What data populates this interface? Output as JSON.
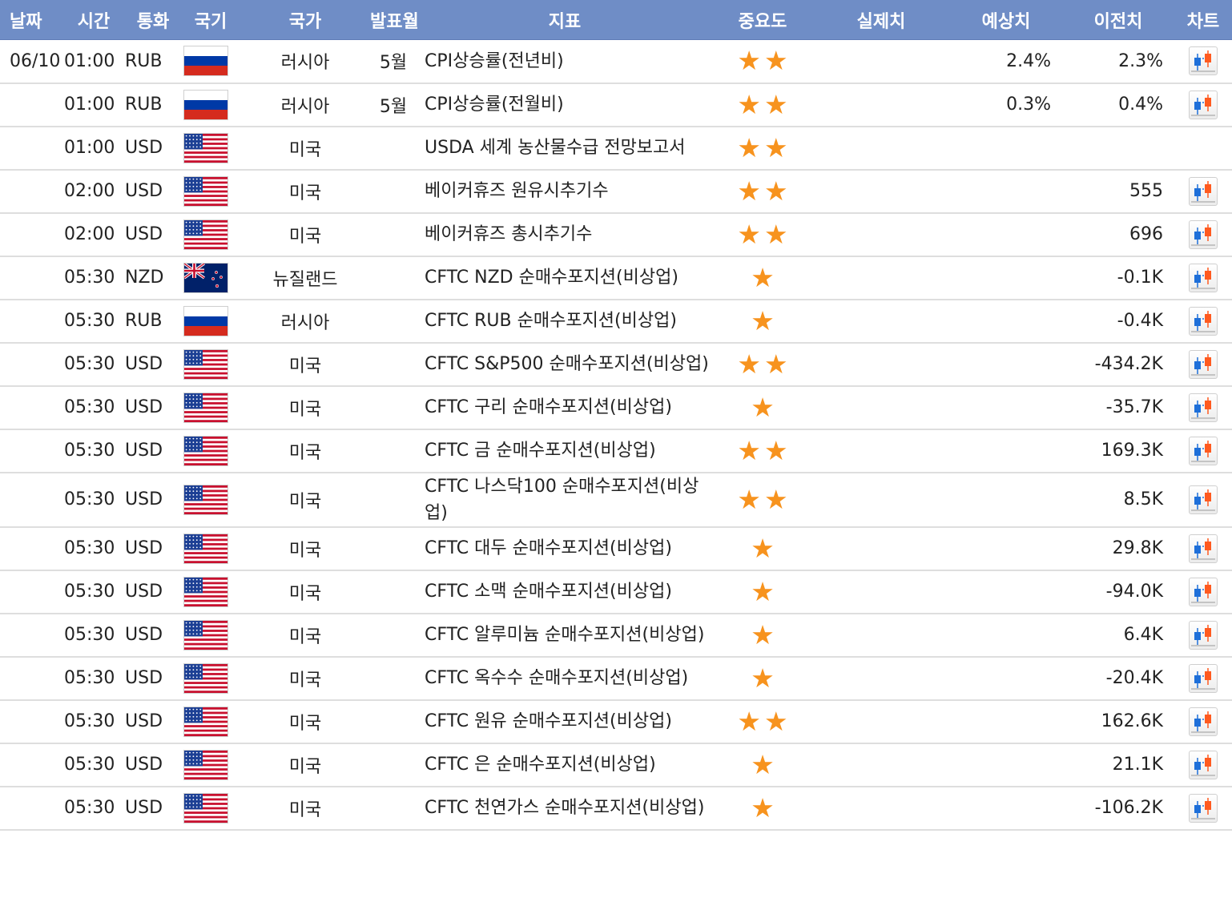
{
  "headers": [
    "날짜",
    "시간",
    "통화",
    "국기",
    "국가",
    "발표월",
    "지표",
    "중요도",
    "실제치",
    "예상치",
    "이전치",
    "차트"
  ],
  "colors": {
    "header_bg": "#6f8dc6",
    "star": "#f7931e",
    "row_border": "#dedede"
  },
  "rows": [
    {
      "date": "06/10",
      "time": "01:00",
      "currency": "RUB",
      "flag": "russia-flag",
      "country": "러시아",
      "month": "5월",
      "indicator": "CPI상승률(전년비)",
      "stars": 2,
      "actual": "",
      "forecast": "2.4%",
      "previous": "2.3%",
      "chart": true
    },
    {
      "date": "",
      "time": "01:00",
      "currency": "RUB",
      "flag": "russia-flag",
      "country": "러시아",
      "month": "5월",
      "indicator": "CPI상승률(전월비)",
      "stars": 2,
      "actual": "",
      "forecast": "0.3%",
      "previous": "0.4%",
      "chart": true
    },
    {
      "date": "",
      "time": "01:00",
      "currency": "USD",
      "flag": "usa-flag",
      "country": "미국",
      "month": "",
      "indicator": "USDA 세계 농산물수급 전망보고서",
      "stars": 2,
      "actual": "",
      "forecast": "",
      "previous": "",
      "chart": false
    },
    {
      "date": "",
      "time": "02:00",
      "currency": "USD",
      "flag": "usa-flag",
      "country": "미국",
      "month": "",
      "indicator": "베이커휴즈 원유시추기수",
      "stars": 2,
      "actual": "",
      "forecast": "",
      "previous": "555",
      "chart": true
    },
    {
      "date": "",
      "time": "02:00",
      "currency": "USD",
      "flag": "usa-flag",
      "country": "미국",
      "month": "",
      "indicator": "베이커휴즈 총시추기수",
      "stars": 2,
      "actual": "",
      "forecast": "",
      "previous": "696",
      "chart": true
    },
    {
      "date": "",
      "time": "05:30",
      "currency": "NZD",
      "flag": "newzealand-flag",
      "country": "뉴질랜드",
      "month": "",
      "indicator": "CFTC NZD 순매수포지션(비상업)",
      "stars": 1,
      "actual": "",
      "forecast": "",
      "previous": "-0.1K",
      "chart": true
    },
    {
      "date": "",
      "time": "05:30",
      "currency": "RUB",
      "flag": "russia-flag",
      "country": "러시아",
      "month": "",
      "indicator": "CFTC RUB 순매수포지션(비상업)",
      "stars": 1,
      "actual": "",
      "forecast": "",
      "previous": "-0.4K",
      "chart": true
    },
    {
      "date": "",
      "time": "05:30",
      "currency": "USD",
      "flag": "usa-flag",
      "country": "미국",
      "month": "",
      "indicator": "CFTC S&P500 순매수포지션(비상업)",
      "stars": 2,
      "actual": "",
      "forecast": "",
      "previous": "-434.2K",
      "chart": true
    },
    {
      "date": "",
      "time": "05:30",
      "currency": "USD",
      "flag": "usa-flag",
      "country": "미국",
      "month": "",
      "indicator": "CFTC 구리 순매수포지션(비상업)",
      "stars": 1,
      "actual": "",
      "forecast": "",
      "previous": "-35.7K",
      "chart": true
    },
    {
      "date": "",
      "time": "05:30",
      "currency": "USD",
      "flag": "usa-flag",
      "country": "미국",
      "month": "",
      "indicator": "CFTC 금 순매수포지션(비상업)",
      "stars": 2,
      "actual": "",
      "forecast": "",
      "previous": "169.3K",
      "chart": true
    },
    {
      "date": "",
      "time": "05:30",
      "currency": "USD",
      "flag": "usa-flag",
      "country": "미국",
      "month": "",
      "indicator": "CFTC 나스닥100 순매수포지션(비상업)",
      "stars": 2,
      "actual": "",
      "forecast": "",
      "previous": "8.5K",
      "chart": true
    },
    {
      "date": "",
      "time": "05:30",
      "currency": "USD",
      "flag": "usa-flag",
      "country": "미국",
      "month": "",
      "indicator": "CFTC 대두 순매수포지션(비상업)",
      "stars": 1,
      "actual": "",
      "forecast": "",
      "previous": "29.8K",
      "chart": true
    },
    {
      "date": "",
      "time": "05:30",
      "currency": "USD",
      "flag": "usa-flag",
      "country": "미국",
      "month": "",
      "indicator": "CFTC 소맥 순매수포지션(비상업)",
      "stars": 1,
      "actual": "",
      "forecast": "",
      "previous": "-94.0K",
      "chart": true
    },
    {
      "date": "",
      "time": "05:30",
      "currency": "USD",
      "flag": "usa-flag",
      "country": "미국",
      "month": "",
      "indicator": "CFTC 알루미늄 순매수포지션(비상업)",
      "stars": 1,
      "actual": "",
      "forecast": "",
      "previous": "6.4K",
      "chart": true
    },
    {
      "date": "",
      "time": "05:30",
      "currency": "USD",
      "flag": "usa-flag",
      "country": "미국",
      "month": "",
      "indicator": "CFTC 옥수수 순매수포지션(비상업)",
      "stars": 1,
      "actual": "",
      "forecast": "",
      "previous": "-20.4K",
      "chart": true
    },
    {
      "date": "",
      "time": "05:30",
      "currency": "USD",
      "flag": "usa-flag",
      "country": "미국",
      "month": "",
      "indicator": "CFTC 원유 순매수포지션(비상업)",
      "stars": 2,
      "actual": "",
      "forecast": "",
      "previous": "162.6K",
      "chart": true
    },
    {
      "date": "",
      "time": "05:30",
      "currency": "USD",
      "flag": "usa-flag",
      "country": "미국",
      "month": "",
      "indicator": "CFTC 은 순매수포지션(비상업)",
      "stars": 1,
      "actual": "",
      "forecast": "",
      "previous": "21.1K",
      "chart": true
    },
    {
      "date": "",
      "time": "05:30",
      "currency": "USD",
      "flag": "usa-flag",
      "country": "미국",
      "month": "",
      "indicator": "CFTC 천연가스 순매수포지션(비상업)",
      "stars": 1,
      "actual": "",
      "forecast": "",
      "previous": "-106.2K",
      "chart": true
    }
  ]
}
